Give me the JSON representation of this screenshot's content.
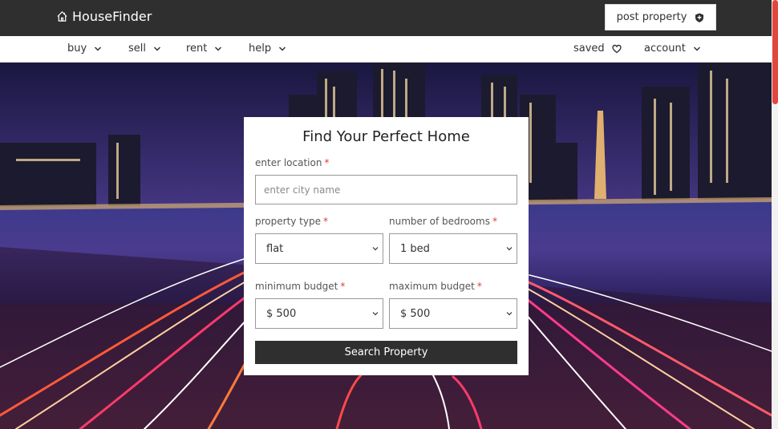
{
  "header": {
    "brand": "HouseFinder",
    "post_property_label": "post property"
  },
  "nav": {
    "left": [
      {
        "label": "buy"
      },
      {
        "label": "sell"
      },
      {
        "label": "rent"
      },
      {
        "label": "help"
      }
    ],
    "saved_label": "saved",
    "account_label": "account"
  },
  "search": {
    "title": "Find Your Perfect Home",
    "location": {
      "label": "enter location",
      "required": "*",
      "placeholder": "enter city name"
    },
    "property_type": {
      "label": "property type",
      "required": "*",
      "value": "flat"
    },
    "bedrooms": {
      "label": "number of bedrooms",
      "required": "*",
      "value": "1 bed"
    },
    "min_budget": {
      "label": "minimum budget",
      "required": "*",
      "value": "$ 500"
    },
    "max_budget": {
      "label": "maximum budget",
      "required": "*",
      "value": "$ 500"
    },
    "submit_label": "Search Property"
  },
  "colors": {
    "header_bg": "#2f2f2f",
    "accent_required": "#e03a3a",
    "button_bg": "#2f2f2f",
    "scroll_thumb": "#e0483e"
  },
  "icons": {
    "brand": "house-icon",
    "post_property": "shield-icon",
    "saved": "heart-icon",
    "dropdown": "chevron-down-icon"
  }
}
